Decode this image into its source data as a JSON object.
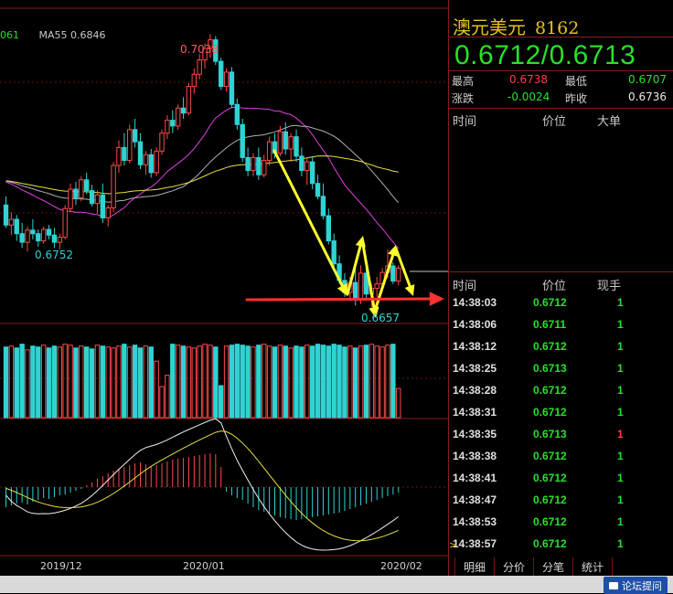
{
  "chart_data": {
    "type": "candlestick",
    "title": "澳元美元 8162",
    "ma_label": "MA55 0.6846",
    "ma_label_prefix": "061",
    "annotations": [
      {
        "text": "0.7038",
        "kind": "high"
      },
      {
        "text": "0.6752",
        "kind": "low"
      },
      {
        "text": "0.6657",
        "kind": "low"
      }
    ],
    "x_tick_labels": [
      "2019/12",
      "2020/01",
      "2020/02"
    ],
    "price_range": [
      0.664,
      0.706
    ],
    "candles": [
      [
        0.68,
        0.6812,
        0.6768,
        0.6772
      ],
      [
        0.6772,
        0.679,
        0.6758,
        0.678
      ],
      [
        0.678,
        0.6786,
        0.675,
        0.676
      ],
      [
        0.676,
        0.6775,
        0.674,
        0.6748
      ],
      [
        0.6748,
        0.677,
        0.6735,
        0.6765
      ],
      [
        0.6765,
        0.678,
        0.6752,
        0.676
      ],
      [
        0.676,
        0.6766,
        0.6742,
        0.675
      ],
      [
        0.675,
        0.677,
        0.6746,
        0.6766
      ],
      [
        0.6766,
        0.6772,
        0.6752,
        0.6758
      ],
      [
        0.6758,
        0.6768,
        0.674,
        0.6748
      ],
      [
        0.6748,
        0.676,
        0.6738,
        0.6755
      ],
      [
        0.6755,
        0.68,
        0.6752,
        0.6795
      ],
      [
        0.6795,
        0.683,
        0.679,
        0.6822
      ],
      [
        0.6822,
        0.6832,
        0.68,
        0.681
      ],
      [
        0.681,
        0.684,
        0.6805,
        0.6835
      ],
      [
        0.6835,
        0.6845,
        0.6815,
        0.682
      ],
      [
        0.682,
        0.6828,
        0.6798,
        0.6802
      ],
      [
        0.6802,
        0.682,
        0.6788,
        0.6814
      ],
      [
        0.6814,
        0.683,
        0.6775,
        0.6782
      ],
      [
        0.6782,
        0.68,
        0.677,
        0.6796
      ],
      [
        0.6796,
        0.686,
        0.679,
        0.6855
      ],
      [
        0.6855,
        0.689,
        0.6845,
        0.688
      ],
      [
        0.688,
        0.69,
        0.6855,
        0.6862
      ],
      [
        0.6862,
        0.6912,
        0.6858,
        0.6905
      ],
      [
        0.6905,
        0.692,
        0.688,
        0.6888
      ],
      [
        0.6888,
        0.69,
        0.685,
        0.6856
      ],
      [
        0.6856,
        0.6875,
        0.6842,
        0.687
      ],
      [
        0.687,
        0.6878,
        0.6838,
        0.6845
      ],
      [
        0.6845,
        0.688,
        0.684,
        0.6875
      ],
      [
        0.6875,
        0.6905,
        0.687,
        0.69
      ],
      [
        0.69,
        0.6925,
        0.6892,
        0.6918
      ],
      [
        0.6918,
        0.6932,
        0.69,
        0.691
      ],
      [
        0.691,
        0.694,
        0.6905,
        0.6935
      ],
      [
        0.6935,
        0.695,
        0.692,
        0.6928
      ],
      [
        0.6928,
        0.697,
        0.6925,
        0.6965
      ],
      [
        0.6965,
        0.699,
        0.6955,
        0.6982
      ],
      [
        0.6982,
        0.701,
        0.6975,
        0.7002
      ],
      [
        0.7002,
        0.7025,
        0.699,
        0.7018
      ],
      [
        0.7018,
        0.7038,
        0.7005,
        0.703
      ],
      [
        0.703,
        0.7035,
        0.6995,
        0.7
      ],
      [
        0.7,
        0.7005,
        0.696,
        0.6965
      ],
      [
        0.6965,
        0.699,
        0.6958,
        0.6985
      ],
      [
        0.6985,
        0.6992,
        0.6935,
        0.694
      ],
      [
        0.694,
        0.6948,
        0.6905,
        0.6912
      ],
      [
        0.6912,
        0.692,
        0.686,
        0.6866
      ],
      [
        0.6866,
        0.688,
        0.684,
        0.6848
      ],
      [
        0.6848,
        0.6872,
        0.684,
        0.6866
      ],
      [
        0.6866,
        0.688,
        0.6835,
        0.6842
      ],
      [
        0.6842,
        0.687,
        0.6838,
        0.6862
      ],
      [
        0.6862,
        0.6895,
        0.6855,
        0.6888
      ],
      [
        0.6888,
        0.69,
        0.6865,
        0.6872
      ],
      [
        0.6872,
        0.691,
        0.6868,
        0.6902
      ],
      [
        0.6902,
        0.6915,
        0.687,
        0.6878
      ],
      [
        0.6878,
        0.69,
        0.686,
        0.6895
      ],
      [
        0.6895,
        0.6905,
        0.686,
        0.6868
      ],
      [
        0.6868,
        0.688,
        0.684,
        0.6848
      ],
      [
        0.6848,
        0.6866,
        0.6828,
        0.686
      ],
      [
        0.686,
        0.6868,
        0.6822,
        0.683
      ],
      [
        0.683,
        0.6842,
        0.6808,
        0.6812
      ],
      [
        0.6812,
        0.683,
        0.678,
        0.6785
      ],
      [
        0.6785,
        0.6795,
        0.6745,
        0.675
      ],
      [
        0.675,
        0.676,
        0.6712,
        0.6718
      ],
      [
        0.6718,
        0.673,
        0.669,
        0.6695
      ],
      [
        0.6695,
        0.6705,
        0.6672,
        0.6678
      ],
      [
        0.6678,
        0.67,
        0.6668,
        0.6692
      ],
      [
        0.6692,
        0.6712,
        0.666,
        0.6668
      ],
      [
        0.6668,
        0.6716,
        0.6662,
        0.6705
      ],
      [
        0.6705,
        0.6722,
        0.667,
        0.6676
      ],
      [
        0.6676,
        0.669,
        0.6657,
        0.6684
      ],
      [
        0.6684,
        0.67,
        0.6672,
        0.669
      ],
      [
        0.669,
        0.6712,
        0.6684,
        0.6706
      ],
      [
        0.6706,
        0.6738,
        0.6698,
        0.6715
      ],
      [
        0.6715,
        0.672,
        0.669,
        0.6694
      ],
      [
        0.6694,
        0.6716,
        0.6688,
        0.6712
      ]
    ],
    "volume": [
      75,
      76,
      74,
      78,
      72,
      76,
      75,
      77,
      74,
      76,
      75,
      78,
      77,
      74,
      76,
      75,
      73,
      77,
      76,
      75,
      74,
      76,
      78,
      75,
      77,
      74,
      76,
      75,
      60,
      33,
      45,
      78,
      77,
      76,
      75,
      74,
      76,
      78,
      77,
      75,
      34,
      76,
      77,
      78,
      77,
      76,
      75,
      77,
      78,
      76,
      75,
      77,
      76,
      74,
      76,
      75,
      77,
      76,
      78,
      77,
      76,
      78,
      77,
      75,
      76,
      74,
      76,
      77,
      78,
      76,
      75,
      77,
      78,
      31
    ],
    "macd_hist": [
      -22,
      -20,
      -18,
      -17,
      -19,
      -16,
      -14,
      -12,
      -13,
      -11,
      -9,
      -8,
      -6,
      -4,
      -2,
      2,
      5,
      9,
      12,
      15,
      18,
      20,
      22,
      24,
      26,
      27,
      25,
      23,
      24,
      26,
      28,
      30,
      31,
      32,
      33,
      34,
      35,
      36,
      37,
      36,
      22,
      -5,
      -9,
      -12,
      -14,
      -18,
      -22,
      -25,
      -27,
      -29,
      -31,
      -33,
      -34,
      -35,
      -36,
      -35,
      -34,
      -33,
      -32,
      -31,
      -30,
      -29,
      -28,
      -26,
      -24,
      -22,
      -20,
      -18,
      -16,
      -14,
      -12,
      -10,
      -8,
      -6
    ]
  },
  "quote": {
    "name": "澳元美元",
    "code": "8162",
    "price": "0.6712/0.6713",
    "high_label": "最高",
    "high": "0.6738",
    "low_label": "最低",
    "low": "0.6707",
    "change_label": "涨跌",
    "change": "-0.0024",
    "prev_close_label": "昨收",
    "prev_close": "0.6736"
  },
  "big_orders": {
    "headers": [
      "时间",
      "价位",
      "大单"
    ]
  },
  "ticks": {
    "headers": [
      "时间",
      "价位",
      "现手"
    ],
    "rows": [
      {
        "time": "14:38:03",
        "price": "0.6712",
        "vol": "1",
        "color": "green"
      },
      {
        "time": "14:38:06",
        "price": "0.6711",
        "vol": "1",
        "color": "green"
      },
      {
        "time": "14:38:12",
        "price": "0.6712",
        "vol": "1",
        "color": "green"
      },
      {
        "time": "14:38:25",
        "price": "0.6713",
        "vol": "1",
        "color": "green"
      },
      {
        "time": "14:38:28",
        "price": "0.6712",
        "vol": "1",
        "color": "green"
      },
      {
        "time": "14:38:31",
        "price": "0.6712",
        "vol": "1",
        "color": "green"
      },
      {
        "time": "14:38:35",
        "price": "0.6713",
        "vol": "1",
        "color": "red"
      },
      {
        "time": "14:38:38",
        "price": "0.6712",
        "vol": "1",
        "color": "green"
      },
      {
        "time": "14:38:41",
        "price": "0.6712",
        "vol": "1",
        "color": "green"
      },
      {
        "time": "14:38:47",
        "price": "0.6712",
        "vol": "1",
        "color": "green"
      },
      {
        "time": "14:38:53",
        "price": "0.6712",
        "vol": "1",
        "color": "green"
      },
      {
        "time": "14:38:57",
        "price": "0.6712",
        "vol": "1",
        "color": "green"
      }
    ]
  },
  "tabs": [
    "明细",
    "分价",
    "分笔",
    "统计"
  ],
  "forum_button": "论坛提问",
  "colors": {
    "up": "#ff4a4a",
    "down": "#2fd3d3",
    "ma_pink": "#e040e0",
    "ma_yellow": "#e8e040",
    "ma_white": "#b0b0b0",
    "arrow_yellow": "#ffff30",
    "arrow_red": "#ff3030"
  }
}
